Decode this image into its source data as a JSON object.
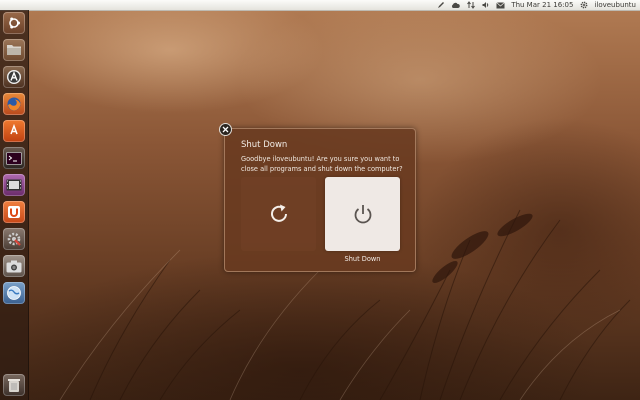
{
  "top_panel": {
    "date_time": "Thu Mar 21  16:05",
    "username": "iloveubuntu",
    "icons": [
      "pencil-icon",
      "cloud-icon",
      "network-arrows-icon",
      "volume-icon",
      "mail-icon",
      "gear-icon"
    ]
  },
  "launcher": {
    "items": [
      {
        "name": "dash-home"
      },
      {
        "name": "home-folder"
      },
      {
        "name": "ubuntu-software-center"
      },
      {
        "name": "firefox"
      },
      {
        "name": "ubuntu-software-alt"
      },
      {
        "name": "terminal"
      },
      {
        "name": "video-player"
      },
      {
        "name": "ubuntu-one"
      },
      {
        "name": "system-settings"
      },
      {
        "name": "screenshot"
      },
      {
        "name": "web-browser"
      },
      {
        "name": "trash"
      }
    ]
  },
  "dialog": {
    "title": "Shut Down",
    "message": "Goodbye iloveubuntu! Are you sure you want to close all programs and shut down the computer?",
    "shutdown_label": "Shut Down",
    "restart_icon": "restart-icon",
    "shutdown_icon": "power-icon",
    "close_icon": "close-icon"
  },
  "colors": {
    "dialog_bg": "#693a20",
    "panel_bg": "#f2f1ed",
    "accent": "#dd4814"
  }
}
